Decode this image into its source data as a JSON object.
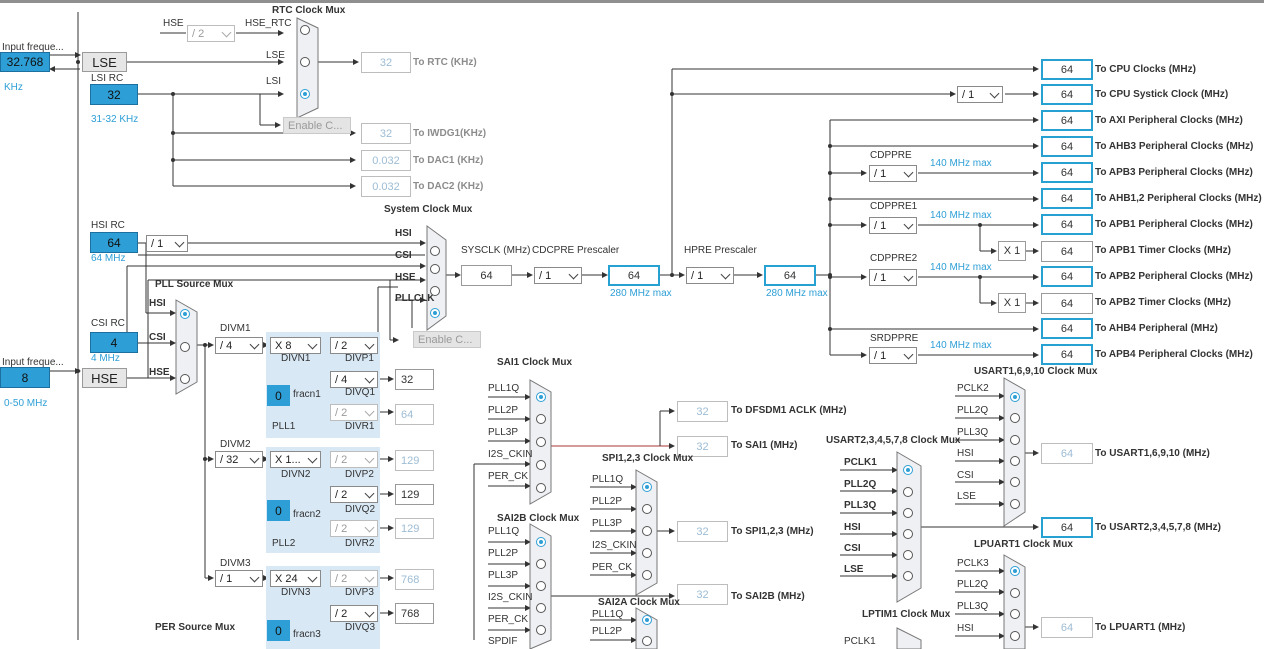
{
  "colors": {
    "accent": "#2e9fd6",
    "panel": "#d9e8f5",
    "wire": "#333333"
  },
  "inputs": {
    "lse": {
      "label": "Input freque...",
      "value": "32.768",
      "unit": "KHz",
      "name": "LSE"
    },
    "hse": {
      "label": "Input freque...",
      "value": "8",
      "range": "0-50 MHz",
      "name": "HSE"
    }
  },
  "oscillators": {
    "lsi": {
      "title": "LSI RC",
      "value": "32",
      "range": "31-32 KHz"
    },
    "hsi": {
      "title": "HSI RC",
      "value": "64",
      "freq": "64 MHz",
      "div": "/ 1"
    },
    "csi": {
      "title": "CSI RC",
      "value": "4",
      "freq": "4 MHz"
    }
  },
  "rtc": {
    "mux_title": "RTC Clock Mux",
    "hse_label": "HSE",
    "hse_rtc_label": "HSE_RTC",
    "hse_div": "/ 2",
    "lse_label": "LSE",
    "lsi_label": "LSI",
    "enable": "Enable C...",
    "outputs": [
      {
        "value": "32",
        "label": "To RTC (KHz)"
      },
      {
        "value": "32",
        "label": "To IWDG1(KHz)"
      },
      {
        "value": "0.032",
        "label": "To DAC1 (KHz)"
      },
      {
        "value": "0.032",
        "label": "To DAC2 (KHz)"
      }
    ]
  },
  "system": {
    "mux_title": "System Clock Mux",
    "inputs": [
      "HSI",
      "CSI",
      "HSE",
      "PLLCLK"
    ],
    "enable": "Enable C...",
    "sysclk_label": "SYSCLK (MHz)",
    "sysclk": "64",
    "cdcpre_label": "CDCPRE Prescaler",
    "cdcpre": "/ 1",
    "cpu_mid": "64",
    "cpu_mid_max": "280 MHz max",
    "hpre_label": "HPRE Prescaler",
    "hpre": "/ 1",
    "hclk": "64",
    "hclk_max": "280 MHz max"
  },
  "pll": {
    "source_mux_title": "PLL Source Mux",
    "source_inputs": [
      "HSI",
      "CSI",
      "HSE"
    ],
    "pll1": {
      "title": "PLL1",
      "divm_label": "DIVM1",
      "divm": "/ 4",
      "divn_label": "DIVN1",
      "divn": "X 8",
      "fracn_label": "fracn1",
      "fracn": "0",
      "divp_label": "DIVP1",
      "divp": "/ 2",
      "divq_label": "DIVQ1",
      "divq": "/ 4",
      "divq_out": "32",
      "divr_label": "DIVR1",
      "divr": "/ 2",
      "divr_out": "64"
    },
    "pll2": {
      "title": "PLL2",
      "divm_label": "DIVM2",
      "divm": "/ 32",
      "divn_label": "DIVN2",
      "divn": "X 1...",
      "fracn_label": "fracn2",
      "fracn": "0",
      "divp_label": "DIVP2",
      "divp": "/ 2",
      "divp_out": "129",
      "divq_label": "DIVQ2",
      "divq": "/ 2",
      "divq_out": "129",
      "divr_label": "DIVR2",
      "divr": "/ 2",
      "divr_out": "129"
    },
    "pll3": {
      "title": "PLL3",
      "divm_label": "DIVM3",
      "divm": "/ 1",
      "divn_label": "DIVN3",
      "divn": "X 24",
      "fracn_label": "fracn3",
      "fracn": "0",
      "divp_label": "DIVP3",
      "divp": "/ 2",
      "divp_out": "768",
      "divq_label": "DIVQ3",
      "divq": "/ 2",
      "divq_out": "768"
    },
    "per_mux_title": "PER Source Mux"
  },
  "right": {
    "cpu": {
      "value": "64",
      "label": "To CPU Clocks (MHz)"
    },
    "systick": {
      "div": "/ 1",
      "value": "64",
      "label": "To CPU Systick Clock (MHz)"
    },
    "axi": {
      "value": "64",
      "label": "To AXI Peripheral Clocks (MHz)"
    },
    "ahb3": {
      "value": "64",
      "label": "To AHB3 Peripheral Clocks  (MHz)"
    },
    "cdppre": {
      "title": "CDPPRE",
      "div": "/ 1",
      "max": "140 MHz max"
    },
    "apb3": {
      "value": "64",
      "label": "To APB3 Peripheral Clocks (MHz)"
    },
    "ahb12": {
      "value": "64",
      "label": "To AHB1,2 Peripheral Clocks (MHz)"
    },
    "cdppre1": {
      "title": "CDPPRE1",
      "div": "/ 1",
      "max": "140 MHz max"
    },
    "apb1": {
      "value": "64",
      "label": "To APB1 Peripheral Clocks (MHz)"
    },
    "apb1t": {
      "mult": "X 1",
      "value": "64",
      "label": "To APB1 Timer Clocks (MHz)"
    },
    "cdppre2": {
      "title": "CDPPRE2",
      "div": "/ 1",
      "max": "140 MHz max"
    },
    "apb2": {
      "value": "64",
      "label": "To APB2 Peripheral Clocks (MHz)"
    },
    "apb2t": {
      "mult": "X 1",
      "value": "64",
      "label": "To APB2 Timer Clocks (MHz)"
    },
    "ahb4": {
      "value": "64",
      "label": "To AHB4 Peripheral (MHz)"
    },
    "srdppre": {
      "title": "SRDPPRE",
      "div": "/ 1",
      "max": "140 MHz max"
    },
    "apb4": {
      "value": "64",
      "label": "To APB4 Peripheral Clocks (MHz)"
    }
  },
  "periph": {
    "sai1": {
      "title": "SAI1 Clock Mux",
      "inputs": [
        "PLL1Q",
        "PLL2P",
        "PLL3P",
        "I2S_CKIN",
        "PER_CK"
      ]
    },
    "dfsdm": {
      "value": "32",
      "label": "To DFSDM1 ACLK (MHz)"
    },
    "sai1_out": {
      "value": "32",
      "label": "To SAI1 (MHz)"
    },
    "spi": {
      "title": "SPI1,2,3 Clock Mux",
      "inputs": [
        "PLL1Q",
        "PLL2P",
        "PLL3P",
        "I2S_CKIN",
        "PER_CK"
      ],
      "value": "32",
      "label": "To SPI1,2,3 (MHz)"
    },
    "sai2b": {
      "title": "SAI2B Clock Mux",
      "inputs": [
        "PLL1Q",
        "PLL2P",
        "PLL3P",
        "I2S_CKIN",
        "PER_CK",
        "SPDIF"
      ],
      "value": "32",
      "label": "To SAI2B (MHz)"
    },
    "sai2a": {
      "title": "SAI2A Clock Mux",
      "inputs": [
        "PLL1Q",
        "PLL2P"
      ]
    },
    "usart2": {
      "title": "USART2,3,4,5,7,8 Clock Mux",
      "inputs": [
        "PCLK1",
        "PLL2Q",
        "PLL3Q",
        "HSI",
        "CSI",
        "LSE"
      ],
      "value": "64",
      "label": "To USART2,3,4,5,7,8 (MHz)"
    },
    "usart1": {
      "title": "USART1,6,9,10 Clock Mux",
      "inputs": [
        "PCLK2",
        "PLL2Q",
        "PLL3Q",
        "HSI",
        "CSI",
        "LSE"
      ],
      "value": "64",
      "label": "To USART1,6,9,10 (MHz)"
    },
    "lpuart": {
      "title": "LPUART1 Clock Mux",
      "inputs": [
        "PCLK3",
        "PLL2Q",
        "PLL3Q",
        "HSI"
      ],
      "value": "64",
      "label": "To LPUART1 (MHz)"
    },
    "lptim": {
      "title": "LPTIM1 Clock Mux",
      "inputs": [
        "PCLK1"
      ]
    }
  }
}
